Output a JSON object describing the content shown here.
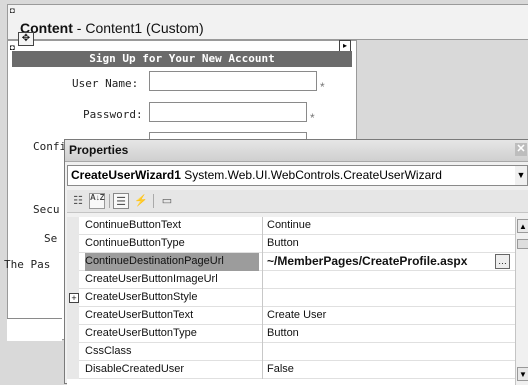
{
  "designer": {
    "content_header": {
      "label_bold": "Content",
      "label_rest": " - Content1 (Custom)"
    },
    "wizard": {
      "banner": "Sign Up for Your New Account",
      "fields": [
        {
          "label": "User Name:",
          "required": "*"
        },
        {
          "label": "Password:",
          "required": "*"
        },
        {
          "label": "Confi"
        },
        {
          "label": "Secu"
        },
        {
          "label": "Se"
        },
        {
          "label": "The Pas"
        }
      ]
    }
  },
  "properties_window": {
    "title": "Properties",
    "object": {
      "name": "CreateUserWizard1",
      "type": " System.Web.UI.WebControls.CreateUserWizard"
    },
    "toolbar": {
      "icons": [
        "categorized-icon",
        "alphabetical-icon",
        "properties-icon",
        "events-icon",
        "property-pages-icon"
      ],
      "alphabetical_glyph": "A↓Z"
    },
    "rows": [
      {
        "name": "ContinueButtonText",
        "value": "Continue"
      },
      {
        "name": "ContinueButtonType",
        "value": "Button"
      },
      {
        "name": "ContinueDestinationPageUrl",
        "value": "~/MemberPages/CreateProfile.aspx",
        "selected": true
      },
      {
        "name": "CreateUserButtonImageUrl",
        "value": ""
      },
      {
        "name": "CreateUserButtonStyle",
        "value": "",
        "expandable": true
      },
      {
        "name": "CreateUserButtonText",
        "value": "Create User"
      },
      {
        "name": "CreateUserButtonType",
        "value": "Button"
      },
      {
        "name": "CssClass",
        "value": ""
      },
      {
        "name": "DisableCreatedUser",
        "value": "False"
      }
    ]
  }
}
